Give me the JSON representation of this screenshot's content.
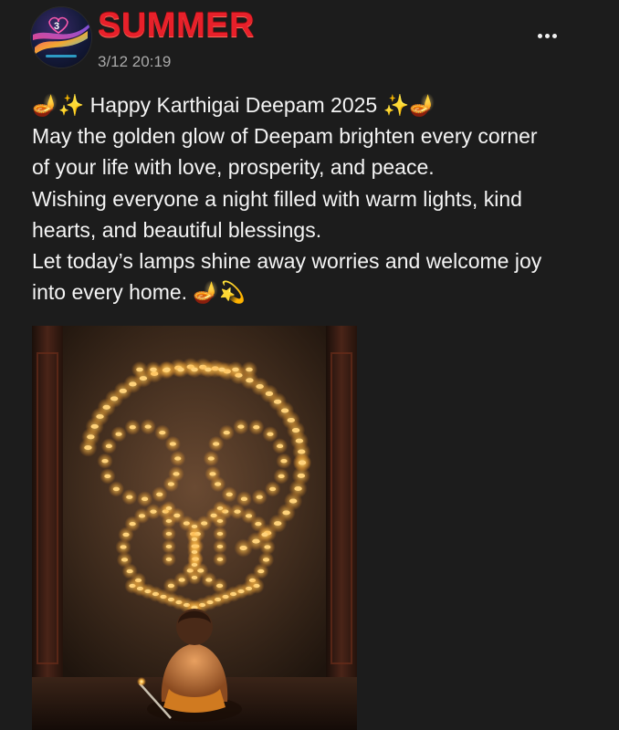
{
  "post": {
    "author": "SUMMER",
    "timestamp": "3/12 20:19",
    "more_icon": "more-horizontal-icon",
    "text_lines": [
      "🪔✨ Happy Karthigai Deepam 2025 ✨🪔",
      "May the golden glow of Deepam brighten every corner",
      "of your life with love, prosperity, and peace.",
      "Wishing everyone a night filled with warm lights, kind",
      "hearts, and beautiful blessings.",
      "Let today’s lamps shine away worries and welcome joy",
      "into every home. 🪔💫"
    ],
    "image": {
      "subject": "child seated before a wall of oil lamps arranged in a large pattern"
    }
  },
  "colors": {
    "background": "#1c1c1c",
    "author": "#e8202a",
    "timestamp": "#a9a9a9",
    "text": "#f4f4f4",
    "lamp_glow": "#ffb547"
  }
}
